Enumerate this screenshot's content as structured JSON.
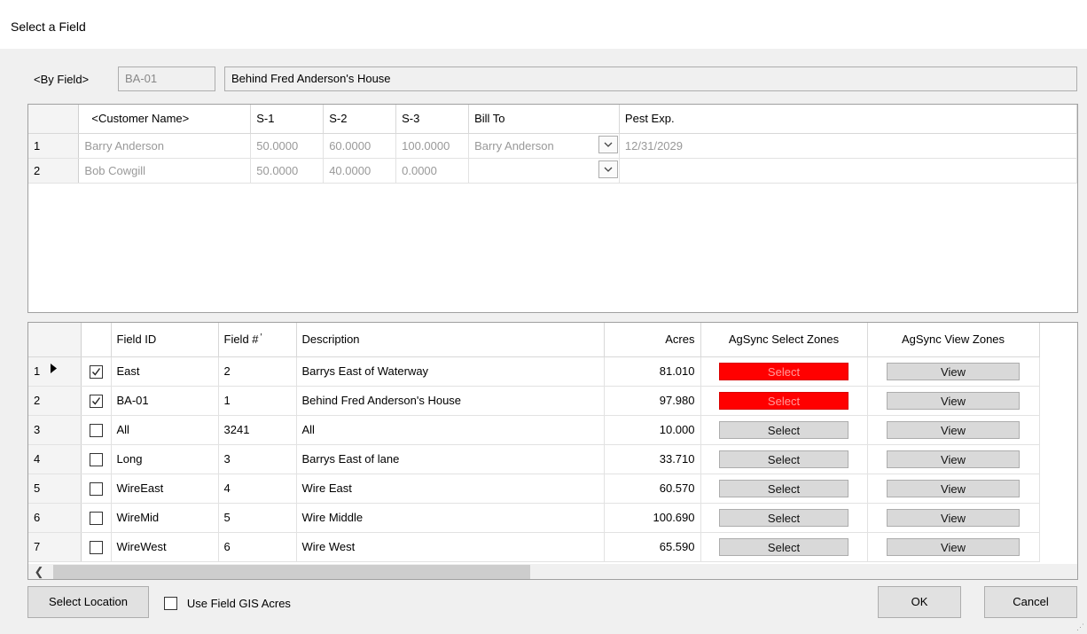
{
  "window": {
    "title": "Select a Field"
  },
  "by_field": {
    "label": "<By Field>",
    "id_value": "BA-01",
    "description_value": "Behind Fred Anderson's House"
  },
  "customers": {
    "columns": [
      "<Customer Name>",
      "S-1",
      "S-2",
      "S-3",
      "Bill To",
      "Pest Exp."
    ],
    "rows": [
      {
        "num": "1",
        "name": "Barry Anderson",
        "s1": "50.0000",
        "s2": "60.0000",
        "s3": "100.0000",
        "bill_to": "Barry Anderson",
        "pest_exp": "12/31/2029"
      },
      {
        "num": "2",
        "name": "Bob Cowgill",
        "s1": "50.0000",
        "s2": "40.0000",
        "s3": "0.0000",
        "bill_to": "",
        "pest_exp": ""
      }
    ]
  },
  "fields": {
    "columns": {
      "field_id": "Field ID",
      "field_num": "Field #",
      "description": "Description",
      "acres": "Acres",
      "select_zones": "AgSync Select Zones",
      "view_zones": "AgSync View Zones"
    },
    "select_label": "Select",
    "view_label": "View",
    "current_row_index": 0,
    "rows": [
      {
        "num": "1",
        "checked": true,
        "field_id": "East",
        "field_num": "2",
        "description": "Barrys East of Waterway",
        "acres": "81.010",
        "select_color": "#ff0000"
      },
      {
        "num": "2",
        "checked": true,
        "field_id": "BA-01",
        "field_num": "1",
        "description": "Behind Fred Anderson's House",
        "acres": "97.980",
        "select_color": "#ff0000"
      },
      {
        "num": "3",
        "checked": false,
        "field_id": "All",
        "field_num": "3241",
        "description": "All",
        "acres": "10.000",
        "select_color": "#d9d9d9"
      },
      {
        "num": "4",
        "checked": false,
        "field_id": "Long",
        "field_num": "3",
        "description": "Barrys East of lane",
        "acres": "33.710",
        "select_color": "#d9d9d9"
      },
      {
        "num": "5",
        "checked": false,
        "field_id": "WireEast",
        "field_num": "4",
        "description": "Wire East",
        "acres": "60.570",
        "select_color": "#d9d9d9"
      },
      {
        "num": "6",
        "checked": false,
        "field_id": "WireMid",
        "field_num": "5",
        "description": "Wire Middle",
        "acres": "100.690",
        "select_color": "#d9d9d9"
      },
      {
        "num": "7",
        "checked": false,
        "field_id": "WireWest",
        "field_num": "6",
        "description": "Wire West",
        "acres": "65.590",
        "select_color": "#d9d9d9"
      }
    ]
  },
  "footer": {
    "select_location": "Select Location",
    "use_gis_label": "Use Field GIS Acres",
    "use_gis_checked": false,
    "ok": "OK",
    "cancel": "Cancel"
  }
}
